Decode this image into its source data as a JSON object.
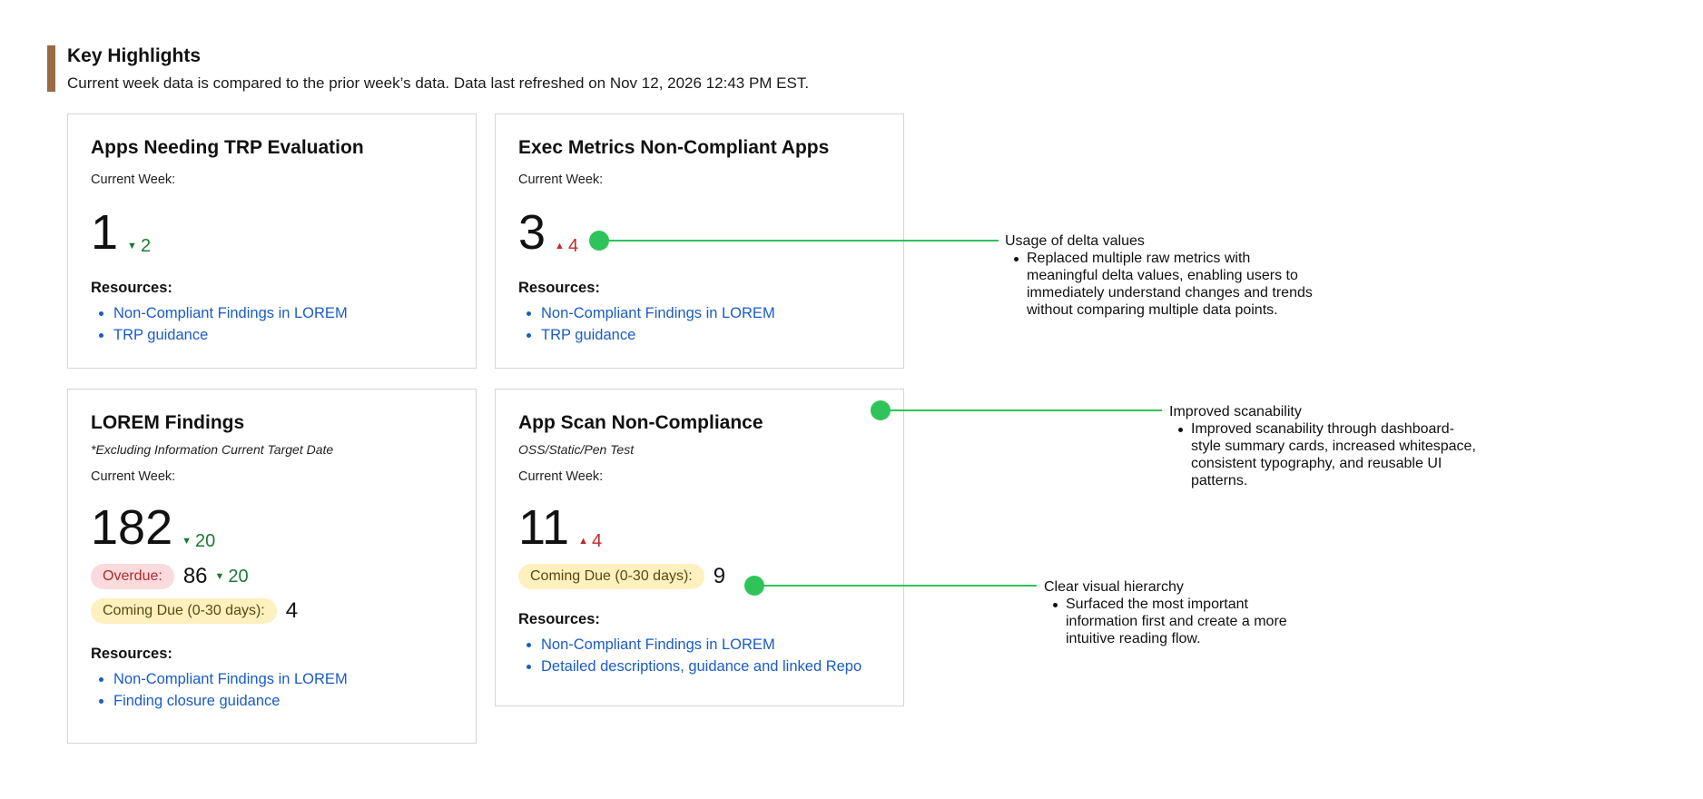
{
  "header": {
    "title": "Key Highlights",
    "subtitle": "Current week data is compared to the prior week’s data. Data last refreshed on Nov 12, 2026 12:43 PM EST.",
    "accent_color": "#9a6a44"
  },
  "cards": [
    {
      "title": "Apps Needing TRP Evaluation",
      "current_week_label": "Current Week:",
      "value": "1",
      "delta": "2",
      "delta_direction": "down",
      "resources_label": "Resources:",
      "resources": [
        "Non-Compliant Findings in LOREM",
        "TRP guidance"
      ]
    },
    {
      "title": "Exec Metrics Non-Compliant Apps",
      "current_week_label": "Current Week:",
      "value": "3",
      "delta": "4",
      "delta_direction": "up",
      "resources_label": "Resources:",
      "resources": [
        "Non-Compliant Findings in LOREM",
        "TRP guidance"
      ]
    },
    {
      "title": "LOREM Findings",
      "note": "*Excluding Information Current Target Date",
      "current_week_label": "Current Week:",
      "value": "182",
      "delta": "20",
      "delta_direction": "down",
      "overdue_label": "Overdue:",
      "overdue_value": "86",
      "overdue_delta": "20",
      "coming_due_label": "Coming Due (0-30 days):",
      "coming_due_value": "4",
      "resources_label": "Resources:",
      "resources": [
        "Non-Compliant Findings in LOREM",
        "Finding closure guidance"
      ]
    },
    {
      "title": "App Scan Non-Compliance",
      "note": "OSS/Static/Pen Test",
      "current_week_label": "Current Week:",
      "value": "11",
      "delta": "4",
      "delta_direction": "up",
      "coming_due_label": "Coming Due (0-30 days):",
      "coming_due_value": "9",
      "resources_label": "Resources:",
      "resources": [
        "Non-Compliant Findings in LOREM",
        "Detailed descriptions, guidance and linked Repo"
      ]
    }
  ],
  "annotations": [
    {
      "title": "Usage of delta values",
      "text": "Replaced multiple raw metrics with meaningful delta values, enabling users to immediately understand changes and trends without comparing multiple data points."
    },
    {
      "title": "Improved scanability",
      "text": "Improved scanability through dashboard-style summary cards, increased whitespace, consistent typography, and reusable UI patterns."
    },
    {
      "title": "Clear visual hierarchy",
      "text": "Surfaced the most important information first and create a more intuitive reading flow."
    }
  ],
  "colors": {
    "delta_down": "#1e7a35",
    "delta_up": "#c22a2a",
    "link": "#1a5cc8",
    "annotation": "#2ec45a",
    "overdue_pill": "#fadadd",
    "coming_due_pill": "#fff0bf"
  },
  "icons": {
    "delta_down": "triangle-down-icon",
    "delta_up": "triangle-up-icon"
  }
}
